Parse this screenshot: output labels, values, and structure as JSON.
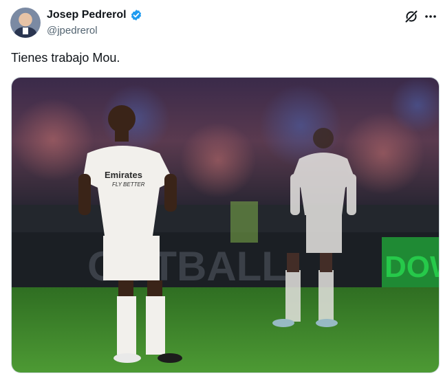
{
  "author": {
    "display_name": "Josep Pedrerol",
    "handle": "@jpedrerol",
    "verified": true,
    "avatar_icon": "profile-photo"
  },
  "header_actions": {
    "grok_icon": "grok-icon",
    "more_icon": "more-options-icon"
  },
  "tweet": {
    "text": "Tienes trabajo Mou."
  },
  "media": {
    "description_icon": "football-photo",
    "kit_sponsor": "Emirates",
    "kit_sponsor_sub": "FLY BETTER",
    "board_text": "OOTBALL",
    "board_text_right": "DOWN"
  },
  "colors": {
    "verified_blue": "#1d9bf0",
    "handle_gray": "#536471",
    "pitch_green": "#3f8a2c"
  }
}
